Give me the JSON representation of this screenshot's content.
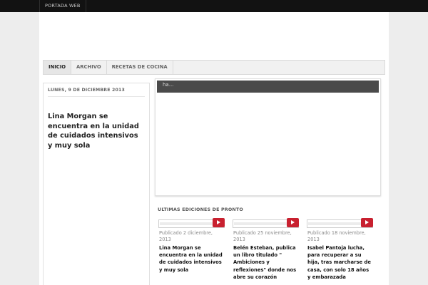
{
  "topbar": {
    "link": "PORTADA WEB"
  },
  "nav": {
    "items": [
      "INICIO",
      "ARCHIVO",
      "RECETAS DE COCINA"
    ]
  },
  "post": {
    "date": "LUNES, 9 DE DICIEMBRE 2013",
    "title": "Lina Morgan se encuentra en la unidad de cuidados intensivos y muy sola"
  },
  "slider": {
    "caption": "ha..."
  },
  "editions": {
    "title": "ULTIMAS EDICIONES DE PRONTO",
    "cards": [
      {
        "date": "Publicado 2 diciembre, 2013",
        "title": "Lina Morgan se encuentra en la unidad de cuidados intensivos y muy sola",
        "icon": "play-icon"
      },
      {
        "date": "Publicado 25 noviembre, 2013",
        "title": "Belén Esteban, publica un libro titulado \" Ambiciones y reflexiones\" donde nos abre su corazón",
        "icon": "play-icon"
      },
      {
        "date": "Publicado 18 noviembre, 2013",
        "title": "Isabel Pantoja lucha, para recuperar a su hija, tras marcharse de casa, con solo 18 años y embarazada",
        "icon": "play-icon"
      }
    ]
  },
  "colors": {
    "topbar": "#121212",
    "accent": "#c8202f",
    "slider": "#4a4a4a",
    "page_bg": "#ededed"
  }
}
